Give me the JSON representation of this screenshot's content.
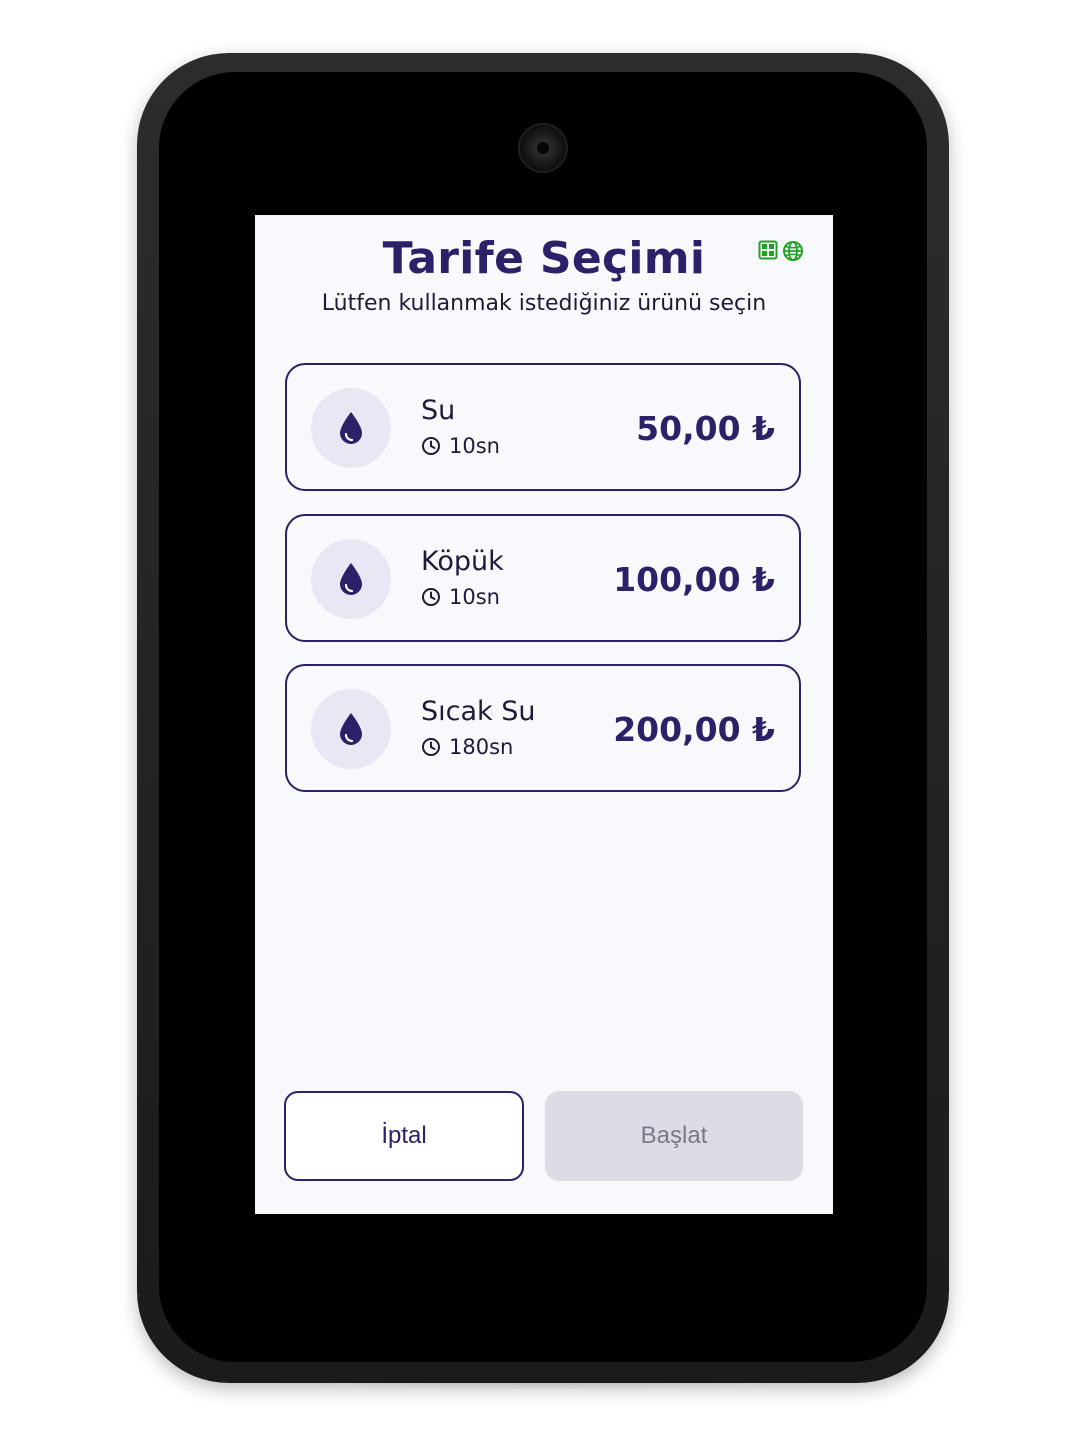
{
  "header": {
    "title": "Tarife Seçimi",
    "subtitle": "Lütfen kullanmak istediğiniz ürünü seçin",
    "status_icons": [
      "grid-icon",
      "globe-icon"
    ],
    "status_color": "#1fa31f"
  },
  "products": [
    {
      "name": "Su",
      "duration": "10sn",
      "price": "50,00 ₺",
      "icon": "water-drop-icon"
    },
    {
      "name": "Köpük",
      "duration": "10sn",
      "price": "100,00 ₺",
      "icon": "water-drop-icon"
    },
    {
      "name": "Sıcak Su",
      "duration": "180sn",
      "price": "200,00 ₺",
      "icon": "water-drop-icon"
    }
  ],
  "actions": {
    "cancel_label": "İptal",
    "start_label": "Başlat"
  },
  "colors": {
    "accent": "#2a2168",
    "icon_bg": "#e8e7f4",
    "screen_bg": "#f8f9fd",
    "disabled_bg": "#dcdce6"
  }
}
